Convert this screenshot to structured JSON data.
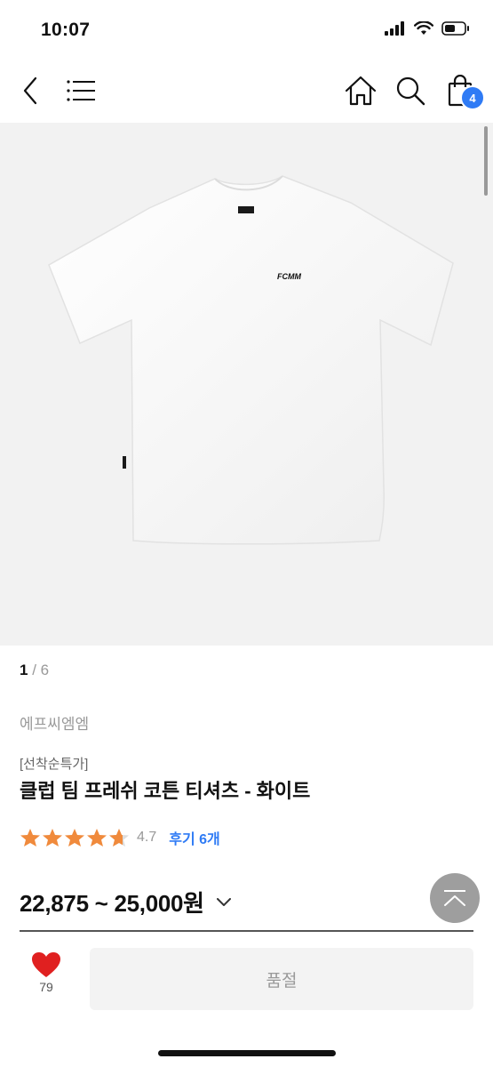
{
  "status": {
    "time": "10:07"
  },
  "nav": {
    "cart_count": "4"
  },
  "product": {
    "pager_current": "1",
    "pager_sep": " / ",
    "pager_total": "6",
    "brand": "에프씨엠엠",
    "tag": "[선착순특가]",
    "title": "클럽 팀 프레쉬 코튼 티셔츠 - 화이트",
    "rating": "4.7",
    "review_link": "후기 6개",
    "price": "22,875 ~ 25,000원",
    "logo_text": "FCMM"
  },
  "bottom": {
    "wish_count": "79",
    "soldout_label": "품절"
  },
  "colors": {
    "accent": "#2f7bf5",
    "star": "#f08a3c",
    "heart": "#e02020"
  },
  "icons": [
    "back-icon",
    "menu-icon",
    "home-icon",
    "search-icon",
    "shopping-bag-icon",
    "star-icon",
    "chevron-down-icon",
    "scroll-top-icon",
    "heart-icon"
  ]
}
